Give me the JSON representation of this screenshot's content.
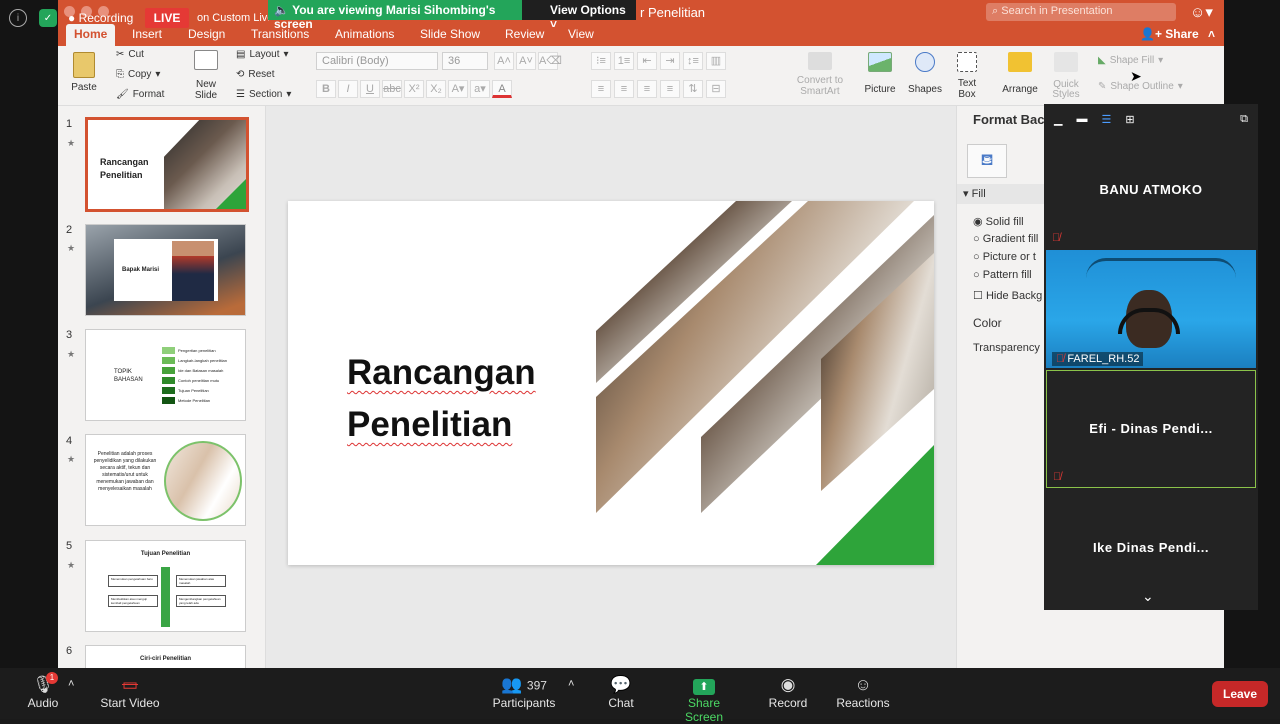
{
  "zoom": {
    "recording_label": "Recording",
    "live_badge": "LIVE",
    "streaming_text": "on Custom Live Streaming service",
    "viewing_banner": "You are viewing Marisi Sihombing's screen",
    "view_options": "View Options",
    "toolbar": {
      "audio": "Audio",
      "start_video": "Start Video",
      "participants": "Participants",
      "participants_count": "397",
      "chat": "Chat",
      "share_screen": "Share Screen",
      "record": "Record",
      "reactions": "Reactions",
      "leave": "Leave"
    },
    "audio_badge": "1",
    "participant_tiles": [
      {
        "name": "BANU ATMOKO"
      },
      {
        "name": "FAREL_RH.52"
      },
      {
        "name": "Efi - Dinas Pendi..."
      },
      {
        "name": "Ike Dinas Pendi..."
      }
    ]
  },
  "ppt": {
    "title_suffix": "r Penelitian",
    "search_placeholder": "Search in Presentation",
    "share_label": "Share",
    "tabs": [
      "Home",
      "Insert",
      "Design",
      "Transitions",
      "Animations",
      "Slide Show",
      "Review",
      "View"
    ],
    "ribbon": {
      "paste": "Paste",
      "cut": "Cut",
      "copy": "Copy",
      "format": "Format",
      "new_slide_1": "New",
      "new_slide_2": "Slide",
      "layout": "Layout",
      "reset": "Reset",
      "section": "Section",
      "font_name": "Calibri (Body)",
      "font_size": "36",
      "convert_1": "Convert to",
      "convert_2": "SmartArt",
      "picture": "Picture",
      "shapes": "Shapes",
      "textbox_1": "Text",
      "textbox_2": "Box",
      "arrange": "Arrange",
      "quick_styles_1": "Quick",
      "quick_styles_2": "Styles",
      "shape_fill": "Shape Fill",
      "shape_outline": "Shape Outline"
    },
    "slide_numbers": [
      "1",
      "2",
      "3",
      "4",
      "5",
      "6"
    ],
    "thumb_texts": {
      "t1": "Rancangan Penelitian",
      "t2": "Bapak Marisi",
      "t3_title": "TOPIK BAHASAN",
      "t3_items": [
        "Pengertian penelitian",
        "Langkah-langkah penelitian",
        "Ide dan Batasan masalah",
        "Contoh penelitian mutu",
        "Tujuan Penelitian",
        "Metode Penelitian"
      ],
      "t4": "Penelitian adalah proses penyelidikan yang dilakukan secara aktif, tekun dan sistematis/urut untuk menemukan jawaban dan menyelesaikan masalah",
      "t5": "Tujuan Penelitian",
      "t5_boxes": [
        "Menemukan pengetahuan baru",
        "Menemukan jawaban atas masalah",
        "Membuktikan atau menguji kembali pengetahuan",
        "Mengembangkan pengetahuan yang telah ada"
      ],
      "t6": "Ciri-ciri Penelitian"
    },
    "slide": {
      "title_line1": "Rancangan",
      "title_line2": "Penelitian"
    },
    "pane": {
      "title": "Format Bac",
      "fill_section": "Fill",
      "options": [
        "Solid fill",
        "Gradient fill",
        "Picture or t",
        "Pattern fill"
      ],
      "hide_bg": "Hide Backg",
      "color": "Color",
      "transparency": "Transparency"
    },
    "colors": {
      "accent": "#d35230",
      "green": "#2ea43a"
    }
  }
}
